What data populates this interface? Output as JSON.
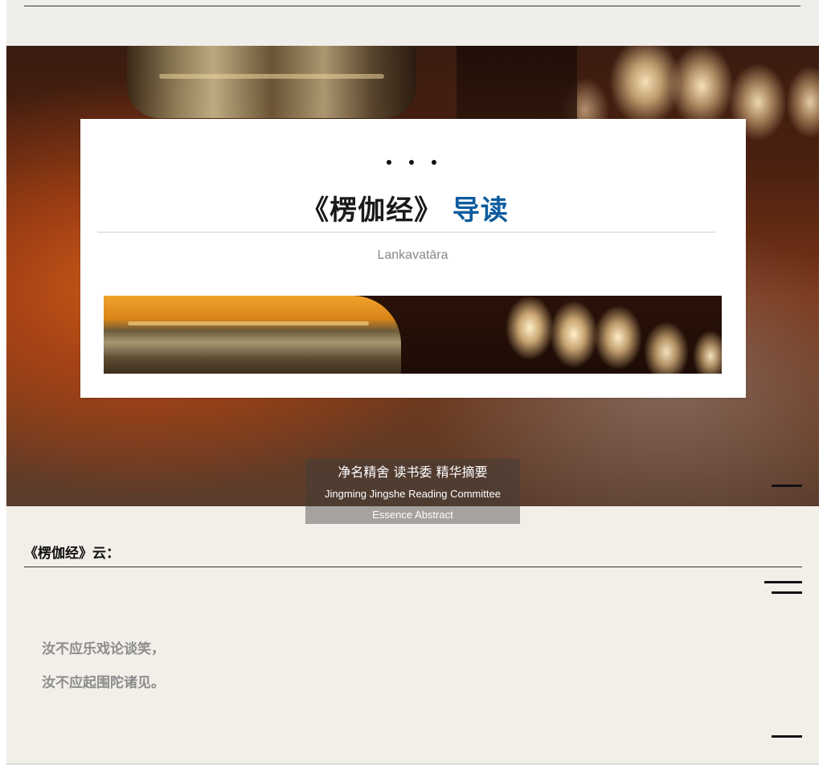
{
  "hero": {
    "title_main": "《楞伽经》",
    "title_accent": "导读",
    "subtitle": "Lankavatāra",
    "caption_zh": "净名精舍 读书委 精华摘要",
    "caption_en_line1": "Jingming Jingshe Reading Committee",
    "caption_en_line2": "Essence Abstract"
  },
  "quote": {
    "label": "《楞伽经》云：",
    "lines": [
      "汝不应乐戏论谈笑，",
      "汝不应起围陀诸见。"
    ]
  },
  "colors": {
    "accent": "#0e5c9f",
    "page_background": "#f2efe9",
    "verse_text": "#8c8c8c"
  }
}
